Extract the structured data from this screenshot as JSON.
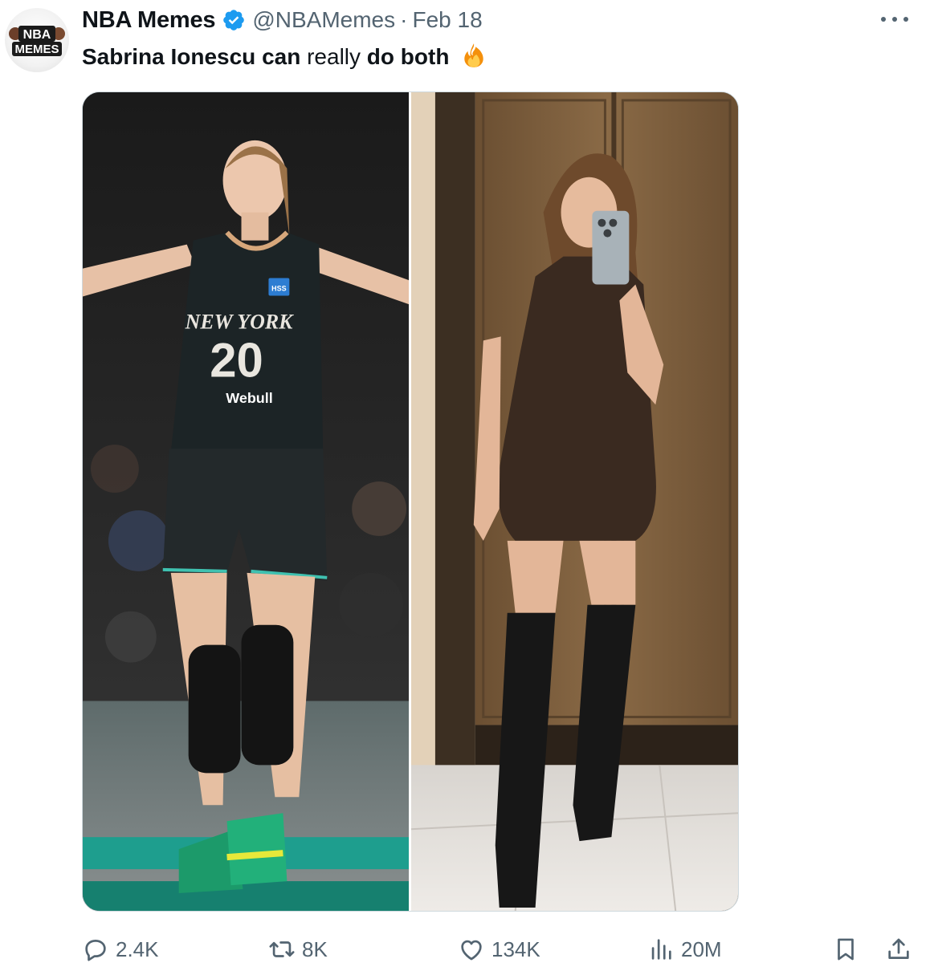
{
  "author": {
    "display_name": "NBA Memes",
    "handle": "@NBAMemes",
    "separator": "·",
    "date": "Feb 18",
    "verified": true,
    "avatar_text_top": "NBA",
    "avatar_text_bottom": "MEMES"
  },
  "tweet": {
    "text_segments": [
      {
        "text": "Sabrina Ionescu can",
        "bold": true
      },
      {
        "text": " really ",
        "bold": false
      },
      {
        "text": "do both",
        "bold": true
      }
    ],
    "emoji": "fire-emoji"
  },
  "media": {
    "left_photo": {
      "jersey_team": "NEW YORK",
      "jersey_number": "20",
      "sponsor": "Webull",
      "patch": "HSS"
    },
    "right_photo": {
      "description_icon": "selfie-photo"
    }
  },
  "actions": {
    "reply_count": "2.4K",
    "retweet_count": "8K",
    "like_count": "134K",
    "views_count": "20M"
  },
  "icons": [
    "more-icon",
    "reply-icon",
    "retweet-icon",
    "like-icon",
    "views-icon",
    "bookmark-icon",
    "share-icon",
    "verified-icon"
  ],
  "colors": {
    "text_primary": "#0f1419",
    "text_secondary": "#536471",
    "verified_blue": "#1d9bf0",
    "border": "#cfd9de"
  }
}
